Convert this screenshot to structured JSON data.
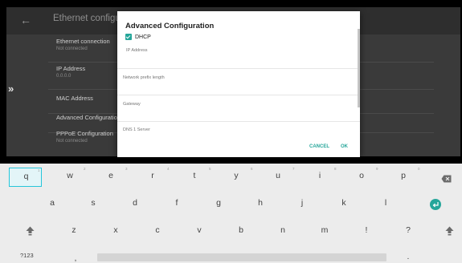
{
  "app": {
    "title": "Ethernet configurat",
    "back_icon": "arrow-back-icon"
  },
  "settings": {
    "items": [
      {
        "title": "Ethernet connection",
        "subtitle": "Not connected"
      },
      {
        "title": "IP Address",
        "subtitle": "0.0.0.0"
      },
      {
        "title": "MAC Address",
        "subtitle": ""
      },
      {
        "title": "Advanced Configuration",
        "subtitle": ""
      },
      {
        "title": "PPPoE Configuration",
        "subtitle": "Not connected"
      }
    ]
  },
  "side_chevron": "»",
  "dialog": {
    "title": "Advanced Configuration",
    "dhcp_label": "DHCP",
    "dhcp_checked": true,
    "fields": [
      {
        "label": "IP Address"
      },
      {
        "label": "Network prefix length"
      },
      {
        "label": "Gateway"
      },
      {
        "label": "DNS 1 Server"
      }
    ],
    "cancel_label": "CANCEL",
    "ok_label": "OK",
    "accent_color": "#26a69a"
  },
  "keyboard": {
    "row1": [
      "q",
      "w",
      "e",
      "r",
      "t",
      "y",
      "u",
      "i",
      "o",
      "p"
    ],
    "row1_numbers": [
      "1",
      "2",
      "3",
      "4",
      "5",
      "6",
      "7",
      "8",
      "9",
      "0"
    ],
    "row2": [
      "a",
      "s",
      "d",
      "f",
      "g",
      "h",
      "j",
      "k",
      "l"
    ],
    "row3": [
      "z",
      "x",
      "c",
      "v",
      "b",
      "n",
      "m",
      "!",
      "?"
    ],
    "symbols_label": "?123",
    "comma": ",",
    "period": ".",
    "icons": {
      "backspace": "backspace-icon",
      "enter": "enter-icon",
      "shift": "shift-icon"
    }
  }
}
